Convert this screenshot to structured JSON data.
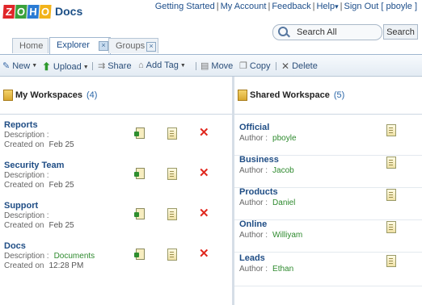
{
  "header": {
    "logo_letters": [
      {
        "letter": "Z",
        "color": "#e0262a"
      },
      {
        "letter": "O",
        "color": "#3aa13c"
      },
      {
        "letter": "H",
        "color": "#2a7bd4"
      },
      {
        "letter": "O",
        "color": "#f2b31a"
      }
    ],
    "app_name": "Docs",
    "links": [
      "Getting Started",
      "My Account",
      "Feedback",
      "Help",
      "Sign Out [ pboyle ]"
    ],
    "help_caret": "▾"
  },
  "tabs": [
    {
      "label": "Home",
      "active": false
    },
    {
      "label": "Explorer",
      "active": true
    },
    {
      "label": "Groups",
      "active": false
    }
  ],
  "search": {
    "placeholder": "Search All",
    "button": "Search"
  },
  "toolbar": {
    "new": "New",
    "upload": "Upload",
    "share": "Share",
    "add_tag": "Add Tag",
    "move": "Move",
    "copy": "Copy",
    "delete": "Delete"
  },
  "my_workspaces": {
    "title": "My Workspaces",
    "count": "(4)",
    "description_label": "Description :",
    "created_label": "Created on",
    "items": [
      {
        "name": "Reports",
        "description": "",
        "created": "Feb 25"
      },
      {
        "name": "Security Team",
        "description": "",
        "created": "Feb 25"
      },
      {
        "name": "Support",
        "description": "",
        "created": "Feb 25"
      },
      {
        "name": "Docs",
        "description": "Documents",
        "created": "12:28 PM"
      }
    ]
  },
  "shared_workspace": {
    "title": "Shared Workspace",
    "count": "(5)",
    "author_label": "Author :",
    "items": [
      {
        "name": "Official",
        "author": "pboyle"
      },
      {
        "name": "Business",
        "author": "Jacob"
      },
      {
        "name": "Products",
        "author": "Daniel"
      },
      {
        "name": "Online",
        "author": "Williyam"
      },
      {
        "name": "Leads",
        "author": "Ethan"
      }
    ]
  },
  "colors": {
    "accent": "#1f4d85",
    "author_green": "#2e8a2e",
    "delete_red": "#e0281e"
  }
}
